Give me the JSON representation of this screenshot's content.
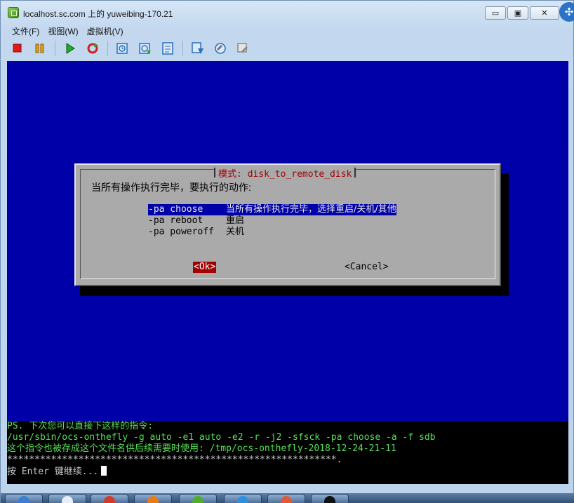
{
  "window": {
    "title": "localhost.sc.com 上的 yuweibing-170.21",
    "minimize_glyph": "▭",
    "restore_glyph": "▣",
    "close_glyph": "✕",
    "badge_glyph": "✣"
  },
  "menubar": {
    "items": [
      "文件(F)",
      "视图(W)",
      "虚拟机(V)"
    ]
  },
  "toolbar": {
    "icons": [
      "stop-icon",
      "pause-icon",
      "play-icon",
      "reset-icon",
      "snapshot-icon",
      "revert-snapshot-icon",
      "manage-snapshot-icon",
      "vm-settings-icon",
      "guest-tools-icon",
      "configure-icon"
    ],
    "colors": {
      "stop": "#e01818",
      "pause": "#e0a010",
      "play": "#1faa2a",
      "reset": "#d02020",
      "tool": "#2a6fc0"
    }
  },
  "console": {
    "background": "#0000a8",
    "dialog": {
      "title": "模式: disk_to_remote_disk",
      "prompt": "当所有操作执行完毕，要执行的动作:",
      "options": [
        {
          "key": "-pa choose",
          "desc": "当所有操作执行完毕，选择重启/关机/其他",
          "selected": true
        },
        {
          "key": "-pa reboot",
          "desc": "重启",
          "selected": false
        },
        {
          "key": "-pa poweroff",
          "desc": "关机",
          "selected": false
        }
      ],
      "ok_label": "<Ok>",
      "cancel_label": "<Cancel>"
    },
    "terminal": {
      "lines": [
        "PS. 下次您可以直接下这样的指令:",
        "/usr/sbin/ocs-onthefly -g auto -e1 auto -e2 -r -j2 -sfsck -pa choose -a -f sdb",
        "这个指令也被存成这个文件名供后续需要时使用: /tmp/ocs-onthefly-2018-12-24-21-11",
        "************************************************************.",
        "按 Enter 键继续..."
      ]
    }
  },
  "taskbar": {
    "buttons": [
      "start-icon",
      "app-2-icon",
      "browser-icon",
      "app-4-icon",
      "vm-icon",
      "app-6-icon",
      "app-7-icon",
      "app-8-icon",
      "terminal-icon"
    ]
  }
}
